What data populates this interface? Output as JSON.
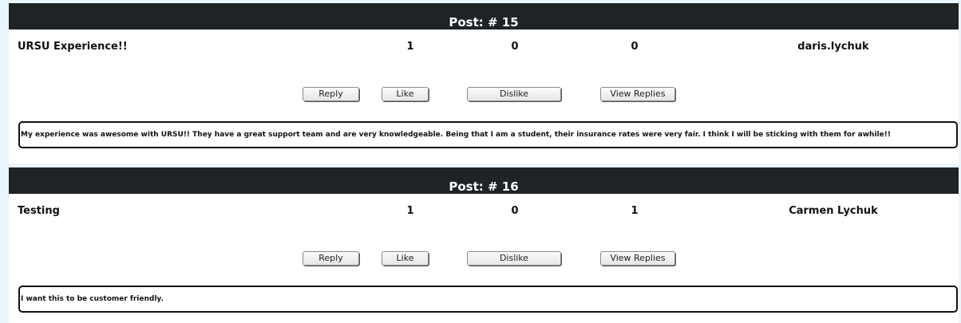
{
  "posts": [
    {
      "title": "Post: # 15",
      "subject": "URSU Experience!!",
      "stat1": "1",
      "stat2": "0",
      "stat3": "0",
      "author": "daris.lychuk",
      "buttons": {
        "reply": "Reply",
        "like": "Like",
        "dislike": "Dislike",
        "view_replies": "View Replies"
      },
      "content": "My experience was awesome with URSU!! They have a great support team and are very knowledgeable. Being that I am a student, their insurance rates were very fair. I think I will be sticking with them for awhile!!"
    },
    {
      "title": "Post: # 16",
      "subject": "Testing",
      "stat1": "1",
      "stat2": "0",
      "stat3": "1",
      "author": "Carmen Lychuk",
      "buttons": {
        "reply": "Reply",
        "like": "Like",
        "dislike": "Dislike",
        "view_replies": "View Replies"
      },
      "content": "I want this to be customer friendly."
    }
  ]
}
